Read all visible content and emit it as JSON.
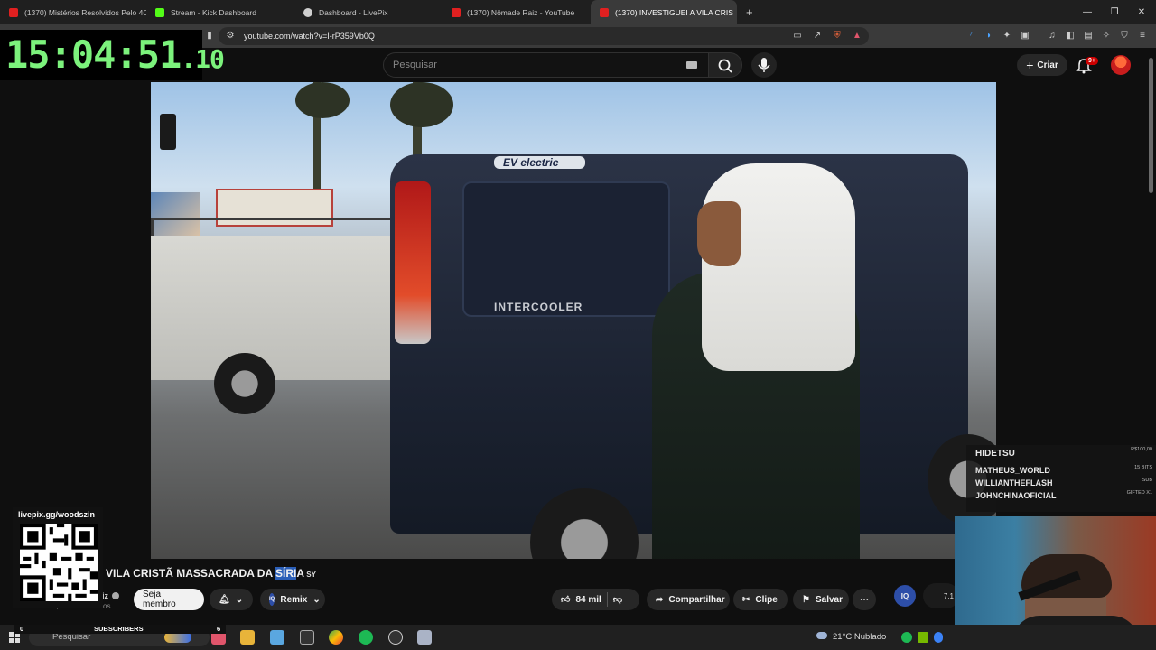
{
  "browser": {
    "tabs": [
      {
        "label": "(1370) Mistérios Resolvidos Pelo 4CH",
        "favicon_color": "#e02020"
      },
      {
        "label": "Stream - Kick Dashboard",
        "favicon_color": "#53fc18"
      },
      {
        "label": "Dashboard - LivePix",
        "favicon_color": "#cfcfcf"
      },
      {
        "label": "(1370) Nômade Raiz - YouTube",
        "favicon_color": "#e02020"
      },
      {
        "label": "(1370) INVESTIGUEI A VILA CRIS",
        "favicon_color": "#e02020"
      }
    ],
    "new_tab": "+",
    "url": "youtube.com/watch?v=I-rP359Vb0Q"
  },
  "timer": {
    "main": "15:04:51",
    "ms": ".10"
  },
  "youtube": {
    "search_placeholder": "Pesquisar",
    "create_label": "Criar",
    "notif_badge": "9+"
  },
  "video": {
    "title_pre": "VILA CRISTÃ MASSACRADA DA ",
    "title_hl": "SÍRI",
    "title_post": "A",
    "title_tail": " SY",
    "van_badge": "INTERCOOLER",
    "van_brand": "EV electric"
  },
  "actions": {
    "member": "Seja membro",
    "remix": "Remix",
    "likes": "84 mil",
    "share": "Compartilhar",
    "clip": "Clipe",
    "save": "Salvar",
    "iq": "IQ",
    "partial_count": "7.1"
  },
  "channel": {
    "partial_name": "iz",
    "partial_subs": "1,5 mi de inscritos"
  },
  "overlay": {
    "livepix": "livepix.gg/woodszin",
    "alerts": [
      {
        "name": "HIDETSU",
        "amount": "R$100,00"
      },
      {
        "name": "MATHEUS_WORLD",
        "amount": "15 BITS"
      },
      {
        "name": "WILLIANTHEFLASH",
        "amount": "SUB"
      },
      {
        "name": "JOHNCHINAOFICIAL",
        "amount": "GIFTED X1"
      }
    ],
    "subs_label": "SUBSCRIBERS",
    "subs_current": "0",
    "subs_goal": "6"
  },
  "taskbar": {
    "search": "Pesquisar",
    "weather": "21°C  Nublado"
  }
}
